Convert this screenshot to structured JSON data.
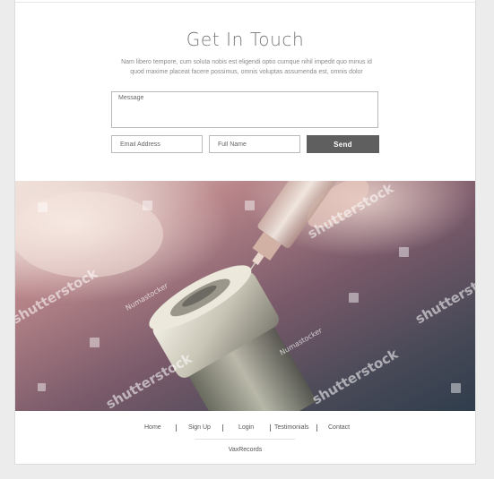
{
  "contact": {
    "title": "Get In Touch",
    "subtitle_line1": "Nam libero tempore, cum soluta nobis est eligendi optio cumque nihil impedit quo minus id",
    "subtitle_line2": "quod maxime placeat facere possimus, omnis voluptas assumenda est, omnis dolor",
    "message_placeholder": "Message",
    "email_placeholder": "Email Address",
    "name_placeholder": "Full Name",
    "send_label": "Send"
  },
  "hero": {
    "watermark_brand": "shutterstock",
    "watermark_secondary": "Numastocker"
  },
  "footer": {
    "links": [
      {
        "label": "Home"
      },
      {
        "label": "Sign Up"
      },
      {
        "label": "Login"
      },
      {
        "label": "Testimonials"
      },
      {
        "label": "Contact"
      }
    ],
    "brand": "VaxRecords"
  },
  "colors": {
    "background": "#ececec",
    "send_button": "#5f5f5f",
    "title_text": "#777777"
  }
}
